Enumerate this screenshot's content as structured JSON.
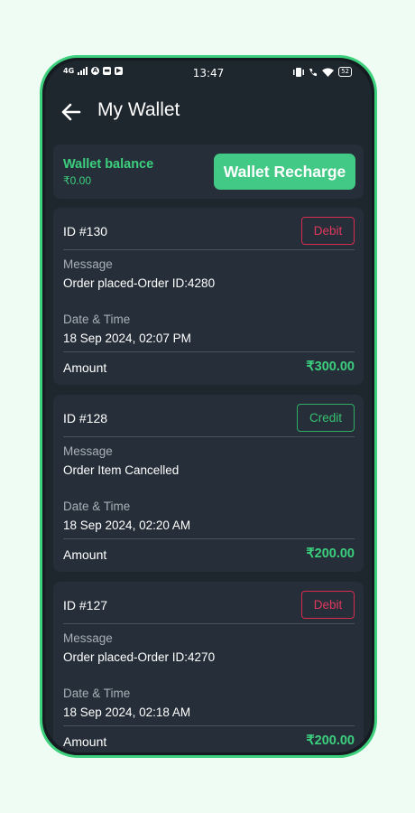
{
  "status_bar": {
    "time": "13:47",
    "network": "4G",
    "battery": "52"
  },
  "app_bar": {
    "title": "My Wallet",
    "back_icon": "arrow-left-icon"
  },
  "wallet": {
    "balance_label": "Wallet balance",
    "balance_value": "₹0.00",
    "recharge_label": "Wallet Recharge"
  },
  "transactions": [
    {
      "id": "ID #130",
      "type": "Debit",
      "message_label": "Message",
      "message": "Order placed-Order ID:4280",
      "datetime_label": "Date & Time",
      "datetime": "18 Sep 2024, 02:07 PM",
      "amount_label": "Amount",
      "amount": "₹300.00"
    },
    {
      "id": "ID #128",
      "type": "Credit",
      "message_label": "Message",
      "message": "Order Item Cancelled",
      "datetime_label": "Date & Time",
      "datetime": "18 Sep 2024, 02:20 AM",
      "amount_label": "Amount",
      "amount": "₹200.00"
    },
    {
      "id": "ID #127",
      "type": "Debit",
      "message_label": "Message",
      "message": "Order placed-Order ID:4270",
      "datetime_label": "Date & Time",
      "datetime": "18 Sep 2024, 02:18 AM",
      "amount_label": "Amount",
      "amount": "₹200.00"
    }
  ],
  "colors": {
    "accent": "#3ccf7e",
    "debit": "#e0385c",
    "credit": "#36c170",
    "card": "#262f39",
    "background": "#1e262e"
  }
}
